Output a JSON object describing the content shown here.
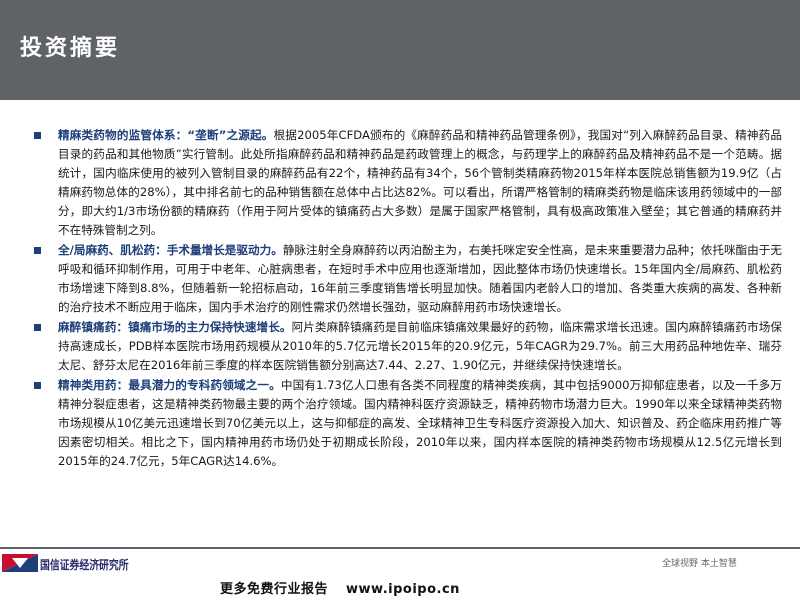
{
  "slide": {
    "title": "投资摘要"
  },
  "bullets": [
    {
      "lead": "精麻类药物的监管体系：“垄断”之源起。",
      "body": "根据2005年CFDA颁布的《麻醉药品和精神药品管理条例》，我国对“列入麻醉药品目录、精神药品目录的药品和其他物质”实行管制。此处所指麻醉药品和精神药品是药政管理上的概念，与药理学上的麻醉药品及精神药品不是一个范畴。据统计，国内临床使用的被列入管制目录的麻醉药品有22个，精神药品有34个，56个管制类精麻药物2015年样本医院总销售额为19.9亿（占精麻药物总体的28%），其中排名前七的品种销售额在总体中占比达82%。可以看出，所谓严格管制的精麻类药物是临床该用药领域中的一部分，即大约1/3市场份额的精麻药（作用于阿片受体的镇痛药占大多数）是属于国家严格管制，具有极高政策准入壁垒；其它普通的精麻药并不在特殊管制之列。"
    },
    {
      "lead": "全/局麻药、肌松药：手术量增长是驱动力。",
      "body": "静脉注射全身麻醉药以丙泊酚主为，右美托咪定安全性高，是未来重要潜力品种；依托咪酯由于无呼吸和循环抑制作用，可用于中老年、心脏病患者，在短时手术中应用也逐渐增加，因此整体市场仍快速增长。15年国内全/局麻药、肌松药市场增速下降到8.8%，但随着新一轮招标启动，16年前三季度销售增长明显加快。随着国内老龄人口的增加、各类重大疾病的高发、各种新的治疗技术不断应用于临床，国内手术治疗的刚性需求仍然增长强劲，驱动麻醉用药市场快速增长。"
    },
    {
      "lead": "麻醉镇痛药：镇痛市场的主力保持快速增长。",
      "body": "阿片类麻醉镇痛药是目前临床镇痛效果最好的药物，临床需求增长迅速。国内麻醉镇痛药市场保持高速成长，PDB样本医院市场用药规模从2010年的5.7亿元增长2015年的20.9亿元，5年CAGR为29.7%。前三大用药品种地佐辛、瑞芬太尼、舒芬太尼在2016年前三季度的样本医院销售额分别高达7.44、2.27、1.90亿元，并继续保持快速增长。"
    },
    {
      "lead": "精神类用药：最具潜力的专科药领域之一。",
      "body": "中国有1.73亿人口患有各类不同程度的精神类疾病，其中包括9000万抑郁症患者，以及一千多万精神分裂症患者，这是精神类药物最主要的两个治疗领域。国内精神科医疗资源缺乏，精神药物市场潜力巨大。1990年以来全球精神类药物市场规模从10亿美元迅速增长到70亿美元以上，这与抑郁症的高发、全球精神卫生专科医疗资源投入加大、知识普及、药企临床用药推广等因素密切相关。相比之下，国内精神用药市场仍处于初期成长阶段，2010年以来，国内样本医院的精神类药物市场规模从12.5亿元增长到2015年的24.7亿元，5年CAGR达14.6%。"
    }
  ],
  "footer": {
    "institute": "国信证券经济研究所",
    "slogan": "全球视野  本土智慧",
    "promo_text": "更多免费行业报告",
    "promo_url": "www.ipoipo.cn"
  },
  "colors": {
    "title_bar": "#5f6267",
    "accent": "#1f3f7a",
    "logo_red": "#c8102e"
  }
}
